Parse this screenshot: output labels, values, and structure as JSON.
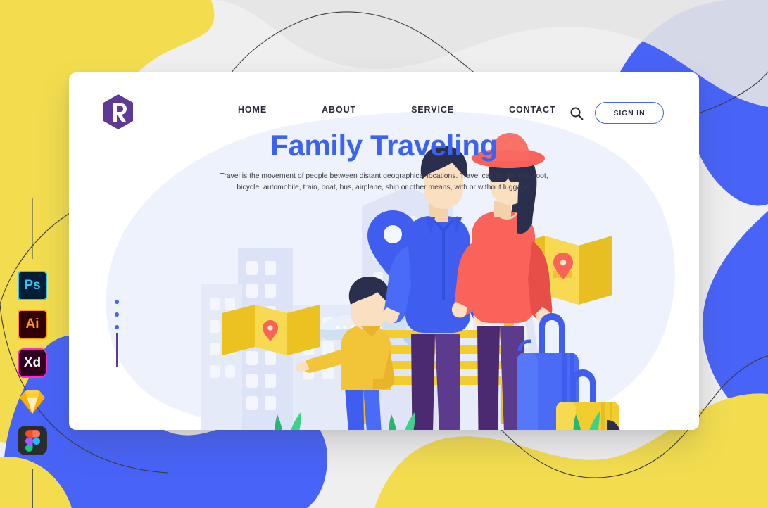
{
  "meta": {
    "page_kind": "landing-page-design-mockup",
    "canvas_bg": "#efefef"
  },
  "palette": {
    "yellow": "#f3dd4e",
    "blue": "#4863f7",
    "royal_blue": "#3b63f0",
    "purple": "#5c3a8e",
    "dark_navy": "#2b2b3d",
    "card_white": "#ffffff",
    "pale_blue_blob": "#eef1fb",
    "red_coral": "#f9635a",
    "gold": "#f2cd2e",
    "green": "#22b573",
    "line_stroke": "#3a3a3a"
  },
  "nav": {
    "logo_letter": "R",
    "logo_name": "hexagon-logo",
    "links": [
      {
        "label": "HOME",
        "name": "nav-link-home"
      },
      {
        "label": "ABOUT",
        "name": "nav-link-about"
      },
      {
        "label": "SERVICE",
        "name": "nav-link-service"
      },
      {
        "label": "CONTACT",
        "name": "nav-link-contact"
      }
    ],
    "search_icon": "search-icon",
    "signin_label": "SIGN IN"
  },
  "hero": {
    "title": "Family Traveling",
    "subtitle": "Travel is the movement of people between distant geographical locations. Travel can be done by foot, bicycle, automobile, train, boat, bus, airplane, ship or other means, with or without luggage."
  },
  "illustration": {
    "name": "family-traveling-illustration",
    "elements": [
      "city-skyline-silhouette",
      "eiffel-tower-silhouette",
      "airplane",
      "map-pin-marker",
      "boy-character-yellow-sweater",
      "man-character-blue-jacket",
      "woman-character-red-hat",
      "folded-map-small",
      "folded-map-large",
      "park-bench",
      "blue-suitcase",
      "yellow-suitcase",
      "potted-plants",
      "ground-line"
    ]
  },
  "app_rail": {
    "icons": [
      {
        "label": "Ps",
        "name": "photoshop-icon",
        "title": "Adobe Photoshop"
      },
      {
        "label": "Ai",
        "name": "illustrator-icon",
        "title": "Adobe Illustrator"
      },
      {
        "label": "Xd",
        "name": "adobe-xd-icon",
        "title": "Adobe XD"
      },
      {
        "label": "",
        "name": "sketch-icon",
        "title": "Sketch"
      },
      {
        "label": "",
        "name": "figma-icon",
        "title": "Figma"
      }
    ]
  },
  "decor": {
    "dots_count": 3,
    "shapes": [
      "yellow-blob-top-left",
      "blue-blob-top-right",
      "blue-blob-bottom-left",
      "yellow-blob-bottom-right",
      "thin-curve-line-top",
      "thin-curve-line-bottom"
    ]
  }
}
